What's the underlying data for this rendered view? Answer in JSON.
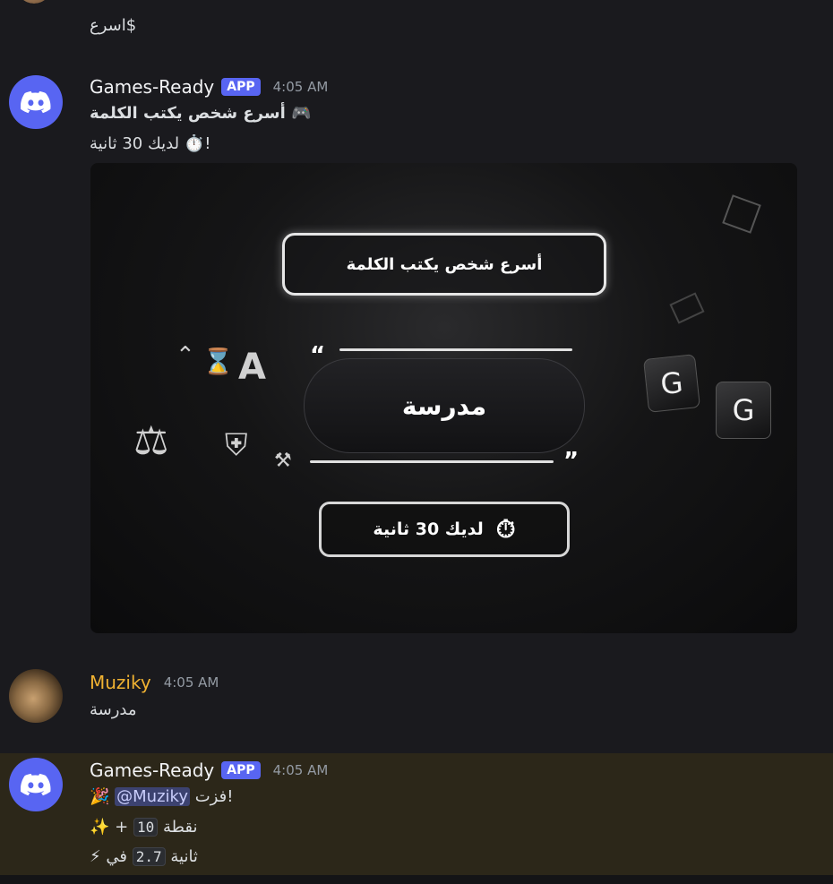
{
  "top": {
    "text": "اسرع$"
  },
  "messages": [
    {
      "username": "Games-Ready",
      "badge": "APP",
      "time": "4:05 AM",
      "line1": "أسرع شخص يكتب الكلمة 🎮",
      "line2": "لديك 30 ثانية ⏱️!",
      "image": {
        "title": "أسرع شخص يكتب الكلمة",
        "word": "مدرسة",
        "timer": "لديك 30 ثانية",
        "keys": [
          "G",
          "G"
        ]
      }
    },
    {
      "username": "Muziky",
      "time": "4:05 AM",
      "text": "مدرسة"
    },
    {
      "username": "Games-Ready",
      "badge": "APP",
      "time": "4:05 AM",
      "win_prefix": "فزت!",
      "mention": "@Muziky",
      "party_emoji": "🎉",
      "points_label": "نقطة",
      "points_value": "10",
      "points_plus": "+",
      "sparkle_emoji": "✨",
      "in_label": "في",
      "seconds_value": "2.7",
      "seconds_label": "ثانية",
      "bolt_emoji": "⚡"
    }
  ],
  "colors": {
    "accent": "#5865f2",
    "username_gold": "#f0b232",
    "highlight_bg": "#2c2719"
  }
}
